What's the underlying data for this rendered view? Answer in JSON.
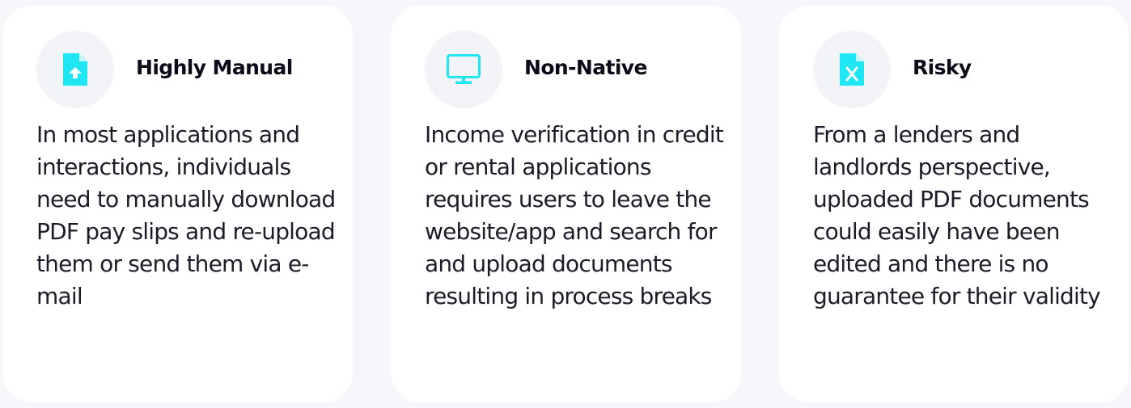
{
  "cards": [
    {
      "icon": "file-upload-icon",
      "title": "Highly Manual",
      "body": "In most applications and interactions, individuals need to manually download PDF pay slips and re-upload them or send them via e-mail"
    },
    {
      "icon": "monitor-icon",
      "title": "Non-Native",
      "body": "Income verification in credit or rental applications requires users to leave the website/app and search for and upload documents resulting in process breaks"
    },
    {
      "icon": "file-x-icon",
      "title": "Risky",
      "body": "From a lenders and landlords perspective, uploaded PDF documents could easily have been edited and there is no guarantee for their validity"
    }
  ],
  "colors": {
    "accent": "#1ee6f2",
    "background": "#f6f7fb",
    "card": "#ffffff",
    "icon_circle": "#f3f4f8",
    "title": "#0b0b1a",
    "body": "#1c1c28"
  }
}
